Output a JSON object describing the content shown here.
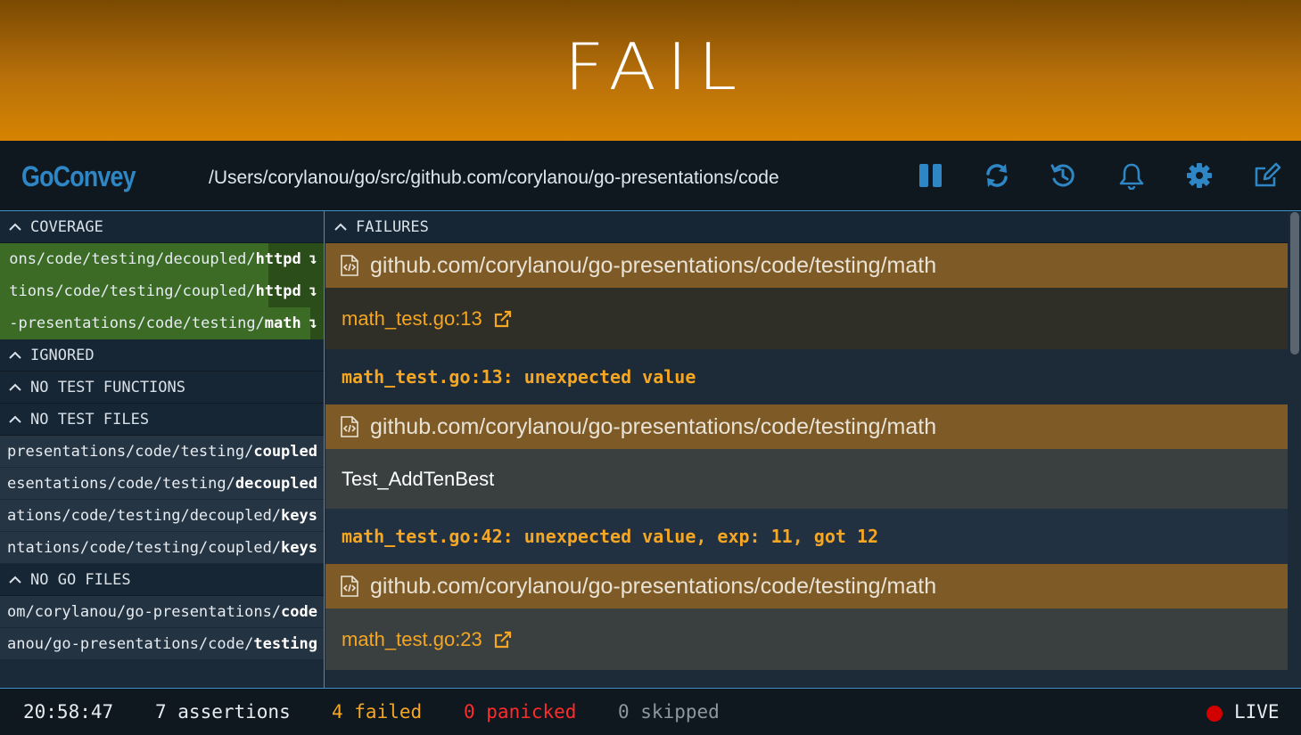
{
  "banner": {
    "status": "FAIL"
  },
  "header": {
    "logo": "GoConvey",
    "path": "/Users/corylanou/go/src/github.com/corylanou/go-presentations/code"
  },
  "toolbar": {
    "icons": [
      "pause-icon",
      "refresh-icon",
      "history-icon",
      "bell-icon",
      "gear-icon",
      "edit-icon"
    ]
  },
  "sidebar": {
    "coverage_label": "COVERAGE",
    "coverage_items": [
      {
        "prefix": "ons/code/testing/decoupled/",
        "bold": "httpd",
        "fraction": 0.17
      },
      {
        "prefix": "tions/code/testing/coupled/",
        "bold": "httpd",
        "fraction": 0.17
      },
      {
        "prefix": "-presentations/code/testing/",
        "bold": "math",
        "fraction": 0.04
      }
    ],
    "ignored_label": "IGNORED",
    "no_test_functions_label": "NO TEST FUNCTIONS",
    "no_test_files_label": "NO TEST FILES",
    "no_test_files_items": [
      {
        "prefix": "presentations/code/testing/",
        "bold": "coupled"
      },
      {
        "prefix": "esentations/code/testing/",
        "bold": "decoupled"
      },
      {
        "prefix": "ations/code/testing/decoupled/",
        "bold": "keys"
      },
      {
        "prefix": "ntations/code/testing/coupled/",
        "bold": "keys"
      }
    ],
    "no_go_files_label": "NO GO FILES",
    "no_go_files_items": [
      {
        "prefix": "om/corylanou/go-presentations/",
        "bold": "code"
      },
      {
        "prefix": "anou/go-presentations/code/",
        "bold": "testing"
      }
    ]
  },
  "main": {
    "failures_label": "FAILURES",
    "failures": [
      {
        "package": "github.com/corylanou/go-presentations/code/testing/math",
        "location": "math_test.go:13",
        "message": "math_test.go:13: unexpected value"
      },
      {
        "package": "github.com/corylanou/go-presentations/code/testing/math",
        "test_name": "Test_AddTenBest",
        "message": "math_test.go:42: unexpected value, exp: 11, got 12"
      },
      {
        "package": "github.com/corylanou/go-presentations/code/testing/math",
        "location": "math_test.go:23"
      }
    ]
  },
  "footer": {
    "time": "20:58:47",
    "assertions": "7 assertions",
    "failed": "4 failed",
    "panicked": "0 panicked",
    "skipped": "0 skipped",
    "live": "LIVE"
  },
  "colors": {
    "accent": "#2f86c4",
    "failure": "#f5a623",
    "panic": "#ff2b2b",
    "live": "#d20000"
  }
}
